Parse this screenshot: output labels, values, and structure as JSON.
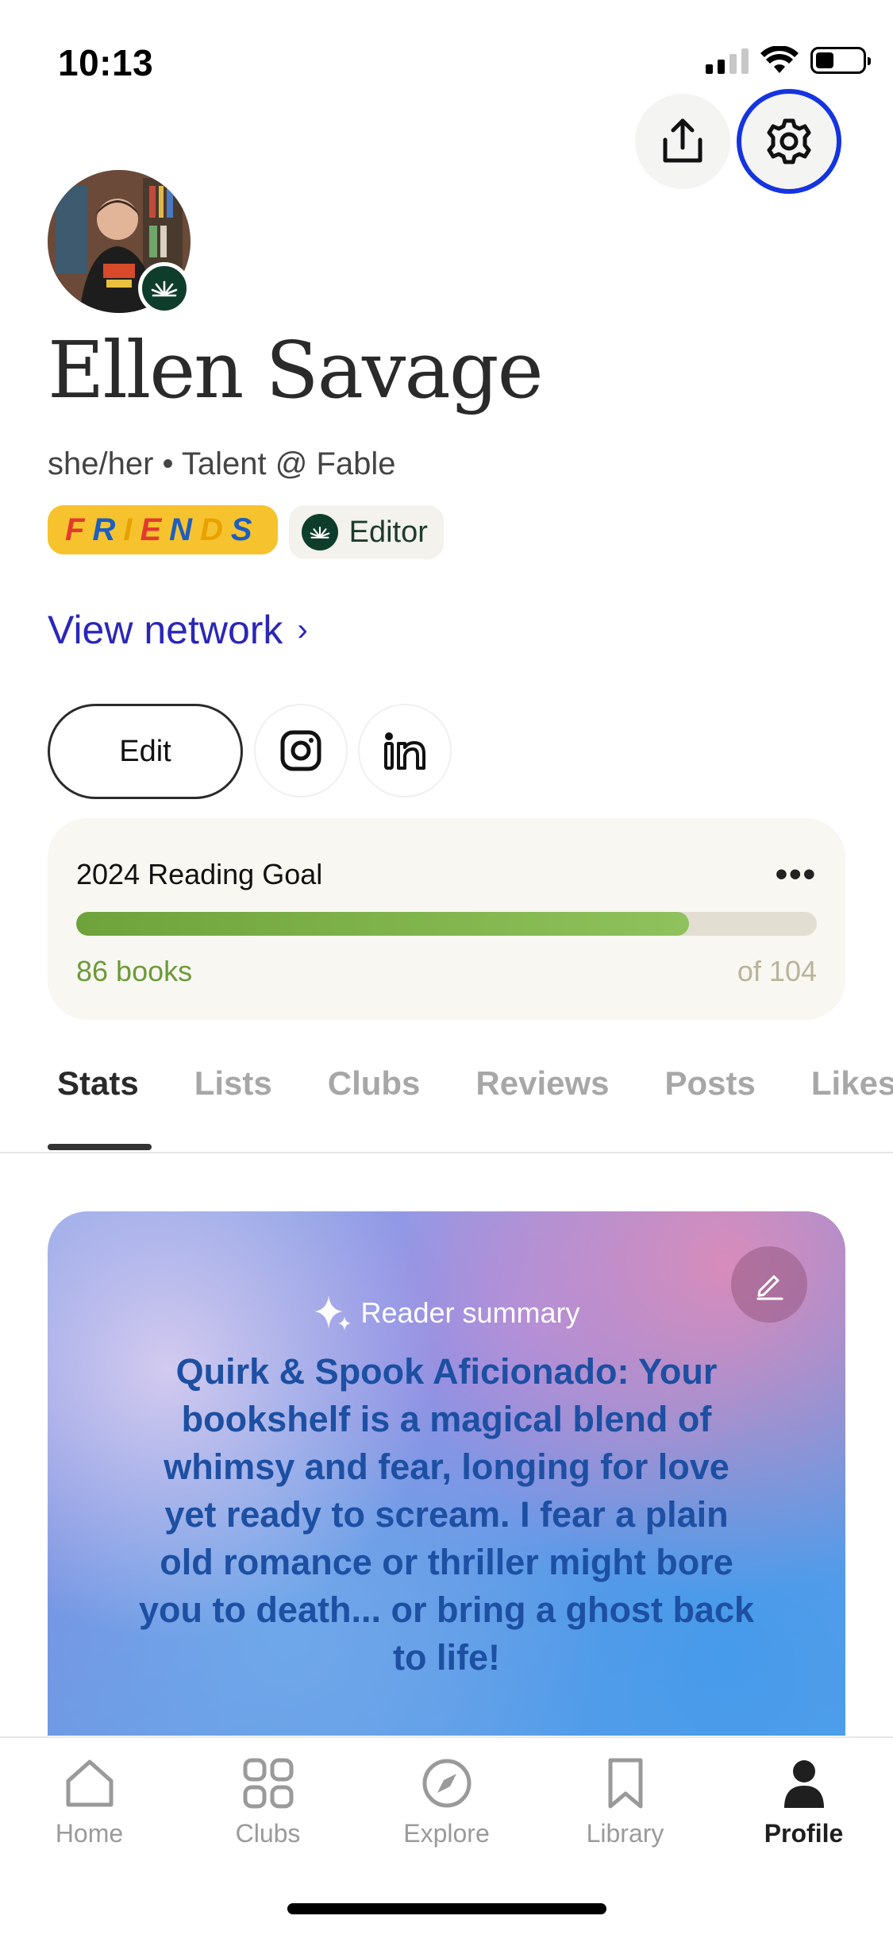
{
  "status_bar": {
    "time": "10:13"
  },
  "profile": {
    "name": "Ellen Savage",
    "subtitle": "she/her • Talent @ Fable",
    "badges": {
      "friends": "FRIENDS",
      "editor": "Editor"
    },
    "view_network": "View network",
    "edit_label": "Edit"
  },
  "reading_goal": {
    "title": "2024 Reading Goal",
    "more": "•••",
    "current_label": "86 books",
    "total_label": "of 104",
    "current": 86,
    "target": 104
  },
  "tabs": [
    {
      "label": "Stats",
      "active": true
    },
    {
      "label": "Lists"
    },
    {
      "label": "Clubs"
    },
    {
      "label": "Reviews"
    },
    {
      "label": "Posts"
    },
    {
      "label": "Likes"
    }
  ],
  "summary": {
    "label": "Reader summary",
    "text": "Quirk & Spook Aficionado: Your bookshelf is a magical blend of whimsy and fear, longing for love yet ready to scream. I fear a plain old romance or thriller might bore you to death... or bring a ghost back to life!"
  },
  "bottom_nav": [
    {
      "label": "Home",
      "icon": "home-icon"
    },
    {
      "label": "Clubs",
      "icon": "clubs-grid-icon"
    },
    {
      "label": "Explore",
      "icon": "compass-icon"
    },
    {
      "label": "Library",
      "icon": "bookmark-icon"
    },
    {
      "label": "Profile",
      "icon": "person-icon",
      "active": true
    }
  ],
  "colors": {
    "accent_link": "#2a27b8",
    "settings_highlight": "#1434e0",
    "goal_progress": "#7aaf45",
    "brand_green": "#0f3d2c"
  }
}
